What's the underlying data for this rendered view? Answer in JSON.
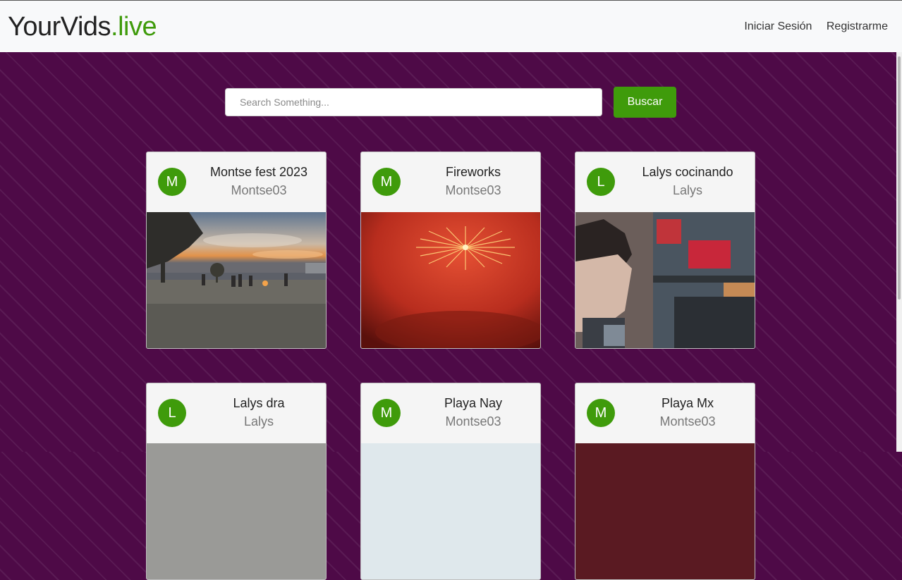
{
  "brand": {
    "name": "YourVids",
    "suffix": ".live"
  },
  "nav": {
    "login": "Iniciar Sesión",
    "register": "Registrarme"
  },
  "search": {
    "placeholder": "Search Something...",
    "button": "Buscar"
  },
  "colors": {
    "accent": "#3f9b0b",
    "background": "#4e0a47",
    "navbar": "#f8f9fa"
  },
  "videos": [
    {
      "title": "Montse fest 2023",
      "author": "Montse03",
      "initial": "M",
      "thumbnail": "sunset-campfire"
    },
    {
      "title": "Fireworks",
      "author": "Montse03",
      "initial": "M",
      "thumbnail": "fireworks"
    },
    {
      "title": "Lalys cocinando",
      "author": "Lalys",
      "initial": "L",
      "thumbnail": "kitchen"
    },
    {
      "title": "Lalys dra",
      "author": "Lalys",
      "initial": "L",
      "thumbnail": "gray"
    },
    {
      "title": "Playa Nay",
      "author": "Montse03",
      "initial": "M",
      "thumbnail": "sky"
    },
    {
      "title": "Playa Mx",
      "author": "Montse03",
      "initial": "M",
      "thumbnail": "dark-red"
    }
  ]
}
